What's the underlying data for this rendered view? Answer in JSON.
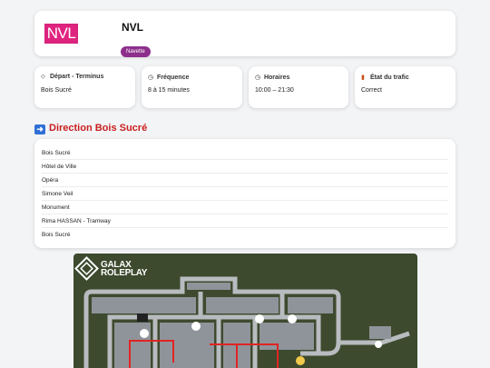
{
  "header": {
    "logo_text": "NVL",
    "line_name": "NVL",
    "badge": "Navette",
    "colors": {
      "logo": "#e0237f",
      "badge": "#8e2f8c"
    }
  },
  "info_cards": [
    {
      "icon": "signpost-icon",
      "title": "Départ - Terminus",
      "value": "Bois Sucré"
    },
    {
      "icon": "clock-icon",
      "title": "Fréquence",
      "value": "8 à 15 minutes"
    },
    {
      "icon": "clock-icon",
      "title": "Horaires",
      "value": "10:00 – 21:30"
    },
    {
      "icon": "traffic-light-icon",
      "title": "État du trafic",
      "value": "Correct"
    }
  ],
  "direction": {
    "title": "Direction Bois Sucré",
    "icon": "arrow-right-icon",
    "color": "#c81e1e",
    "stops": [
      "Bois Sucré",
      "Hôtel de Ville",
      "Opéra",
      "Simone Veil",
      "Monument",
      "Rima HASSAN - Tramway",
      "Bois Sucré"
    ]
  },
  "map": {
    "brand_line1": "GALAX",
    "brand_line2": "ROLEPLAY"
  }
}
